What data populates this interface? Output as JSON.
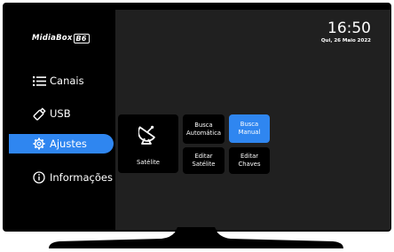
{
  "brand": {
    "logo_text": "MidiaBox",
    "logo_badge": "B6"
  },
  "clock": {
    "time": "16:50",
    "date": "Qui, 26 Maio 2022"
  },
  "sidebar": {
    "items": [
      {
        "label": "Canais",
        "icon": "list-icon"
      },
      {
        "label": "USB",
        "icon": "usb-icon"
      },
      {
        "label": "Ajustes",
        "icon": "gear-icon",
        "active": true
      },
      {
        "label": "Informações",
        "icon": "info-icon"
      }
    ]
  },
  "tiles": {
    "satelite": {
      "label": "Satélite",
      "icon": "satellite-dish-icon"
    },
    "busca_automatica": {
      "line1": "Busca",
      "line2": "Automática"
    },
    "busca_manual": {
      "line1": "Busca",
      "line2": "Manual",
      "selected": true
    },
    "editar_satelite": {
      "line1": "Editar",
      "line2": "Satélite"
    },
    "editar_chaves": {
      "line1": "Editar",
      "line2": "Chaves"
    }
  },
  "colors": {
    "accent": "#2f86f0",
    "screen_bg": "#202020",
    "sidebar_bg": "#000000"
  }
}
